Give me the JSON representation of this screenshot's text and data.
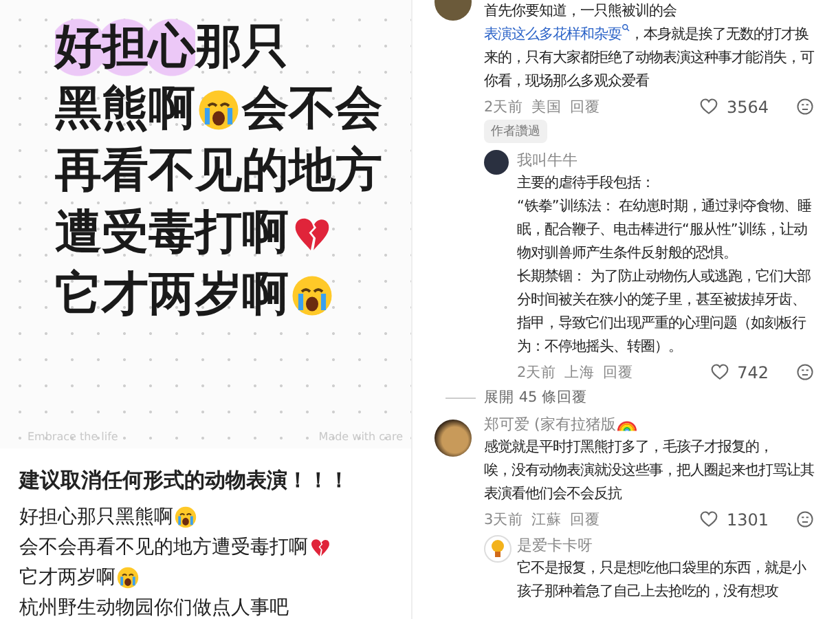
{
  "post": {
    "title_lines": [
      [
        {
          "kind": "text",
          "text": "好担心",
          "highlighted": true
        },
        {
          "kind": "text",
          "text": "那只",
          "highlighted": false
        }
      ],
      [
        {
          "kind": "text",
          "text": "黑熊啊",
          "highlighted": false
        },
        {
          "kind": "crying-emoji"
        },
        {
          "kind": "text",
          "text": "会不会",
          "highlighted": false
        }
      ],
      [
        {
          "kind": "text",
          "text": "再看不见的地方",
          "highlighted": false
        }
      ],
      [
        {
          "kind": "text",
          "text": "遭受毒打啊",
          "highlighted": false
        },
        {
          "kind": "broken-heart-emoji"
        }
      ],
      [
        {
          "kind": "text",
          "text": "它才两岁啊",
          "highlighted": false
        },
        {
          "kind": "crying-emoji"
        }
      ]
    ],
    "watermark_left": "Embrace the life",
    "watermark_right": "Made with care",
    "heading": "建议取消任何形式的动物表演！！！",
    "body_lines": [
      [
        {
          "kind": "text",
          "text": "好担心那只黑熊啊"
        },
        {
          "kind": "crying-emoji"
        }
      ],
      [
        {
          "kind": "text",
          "text": "会不会再看不见的地方遭受毒打啊"
        },
        {
          "kind": "broken-heart-emoji"
        }
      ],
      [
        {
          "kind": "text",
          "text": "它才两岁啊"
        },
        {
          "kind": "crying-emoji"
        }
      ],
      [
        {
          "kind": "text",
          "text": "杭州野生动物园你们做点人事吧"
        }
      ]
    ]
  },
  "comments": [
    {
      "paragraphs": [
        [
          {
            "kind": "text",
            "text": "首先你要知道，一只熊被训的会 "
          },
          {
            "kind": "link",
            "text": "表演这么多花样和杂耍"
          },
          {
            "kind": "text",
            "text": "，本身就是挨了无数的打才换来的，只有大家都拒绝了动物表演这种事才能消失，可你看，现场那么多观众爱看"
          }
        ]
      ],
      "time": "2天前",
      "location": "美国",
      "reply": "回覆",
      "likes": "3564",
      "badge": "作者讚過",
      "replies": [
        {
          "author": [
            {
              "kind": "text",
              "text": "我叫牛牛"
            }
          ],
          "paragraphs": [
            [
              {
                "kind": "text",
                "text": "主要的虐待手段包括："
              }
            ],
            [
              {
                "kind": "text",
                "text": "“铁拳”训练法： 在幼崽时期，通过剥夺食物、睡眠，配合鞭子、电击棒进行“服从性”训练，让动物对驯兽师产生条件反射般的恐惧。"
              }
            ],
            [
              {
                "kind": "text",
                "text": "长期禁锢： 为了防止动物伤人或逃跑，它们大部分时间被关在狭小的笼子里，甚至被拔掉牙齿、指甲，导致它们出现严重的心理问题（如刻板行为：不停地摇头、转圈）。"
              }
            ]
          ],
          "time": "2天前",
          "location": "上海",
          "reply": "回覆",
          "likes": "742"
        }
      ],
      "expand": "展開 45 條回覆"
    },
    {
      "author": [
        {
          "kind": "text",
          "text": "郑可爱 (家有拉猪版"
        },
        {
          "kind": "rainbow-emoji"
        }
      ],
      "paragraphs": [
        [
          {
            "kind": "text",
            "text": "感觉就是平时打黑熊打多了，毛孩子才报复的，"
          }
        ],
        [
          {
            "kind": "text",
            "text": "唉，没有动物表演就没这些事，把人圈起来也打骂让其表演看他们会不会反抗"
          }
        ]
      ],
      "time": "3天前",
      "location": "江蘇",
      "reply": "回覆",
      "likes": "1301",
      "replies": [
        {
          "author": [
            {
              "kind": "text",
              "text": "是爱卡卡呀"
            }
          ],
          "paragraphs": [
            [
              {
                "kind": "text",
                "text": "它不是报复，只是想吃他口袋里的东西，就是小孩子那种着急了自己上去抢吃的，没有想攻"
              }
            ]
          ]
        }
      ]
    }
  ]
}
